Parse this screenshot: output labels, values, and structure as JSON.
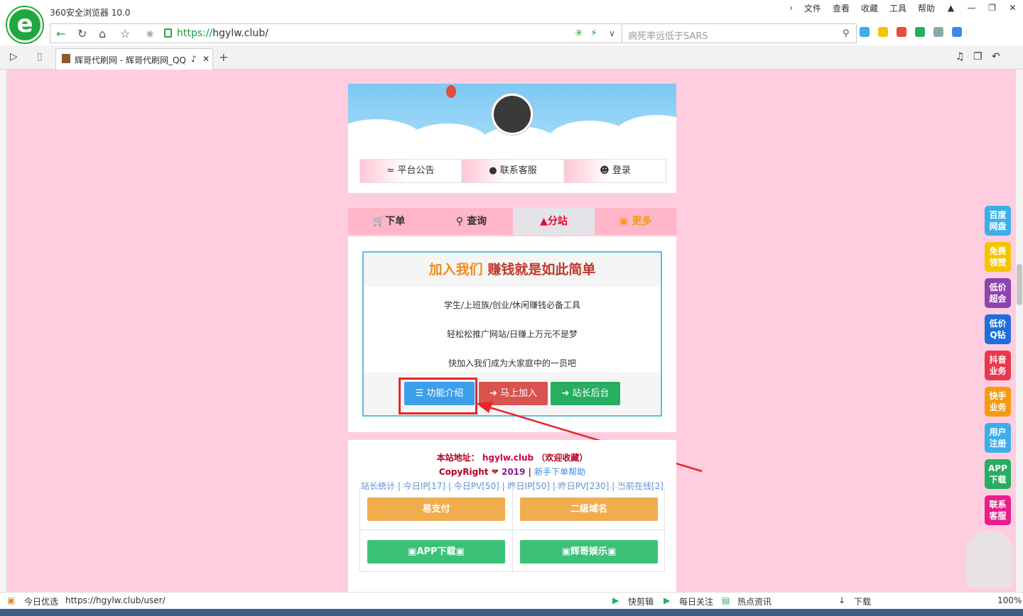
{
  "browser": {
    "title": "360安全浏览器 10.0",
    "menu": [
      "文件",
      "查看",
      "收藏",
      "工具",
      "帮助"
    ],
    "url_scheme": "https://",
    "url_host": "hgylw.club/",
    "search_placeholder": "病死率远低于SARS",
    "tab_title": "辉哥代刷网 - 辉哥代刷网_QQ",
    "status_url": "https://hgylw.club/user/",
    "status_left": "今日优选",
    "status_items": [
      "快剪辑",
      "每日关注",
      "热点资讯",
      "下载"
    ],
    "zoom": "100%"
  },
  "page": {
    "top_buttons": [
      "平台公告",
      "联系客服",
      "登录"
    ],
    "tabs": [
      "下单",
      "查询",
      "分站",
      "更多"
    ],
    "active_tab": "分站",
    "join": {
      "title_a": "加入我们",
      "title_b": "赚钱就是如此简单",
      "lines": [
        "学生/上班族/创业/休闲赚钱必备工具",
        "轻松松推广网站/日赚上万元不是梦",
        "快加入我们成为大家庭中的一员吧"
      ],
      "buttons": [
        "功能介绍",
        "马上加入",
        "站长后台"
      ]
    },
    "footer": {
      "site_label": "本站地址：",
      "site_host": "hgylw.club",
      "site_note": "（欢迎收藏）",
      "copyright": "CopyRight",
      "year": "2019",
      "help": "新手下单帮助",
      "stats": "站长统计 | 今日IP[17] | 今日PV[50] | 昨日IP[50] | 昨日PV[230] | 当前在线[2]",
      "grid_buttons": [
        "易支付",
        "二级域名",
        "APP下载",
        "辉哥娱乐"
      ]
    },
    "side_links": [
      {
        "label_1": "百度",
        "label_2": "网盘",
        "color": "#3daee9"
      },
      {
        "label_1": "免费",
        "label_2": "领赞",
        "color": "#f5c400"
      },
      {
        "label_1": "低价",
        "label_2": "超会",
        "color": "#8e44ad"
      },
      {
        "label_1": "低价",
        "label_2": "Q钻",
        "color": "#1e6fd9"
      },
      {
        "label_1": "抖音",
        "label_2": "业务",
        "color": "#e8384f"
      },
      {
        "label_1": "快手",
        "label_2": "业务",
        "color": "#f39c12"
      },
      {
        "label_1": "用户",
        "label_2": "注册",
        "color": "#3daee9"
      },
      {
        "label_1": "APP",
        "label_2": "下载",
        "color": "#27ae60"
      },
      {
        "label_1": "联系",
        "label_2": "客服",
        "color": "#e91e8c"
      }
    ]
  }
}
